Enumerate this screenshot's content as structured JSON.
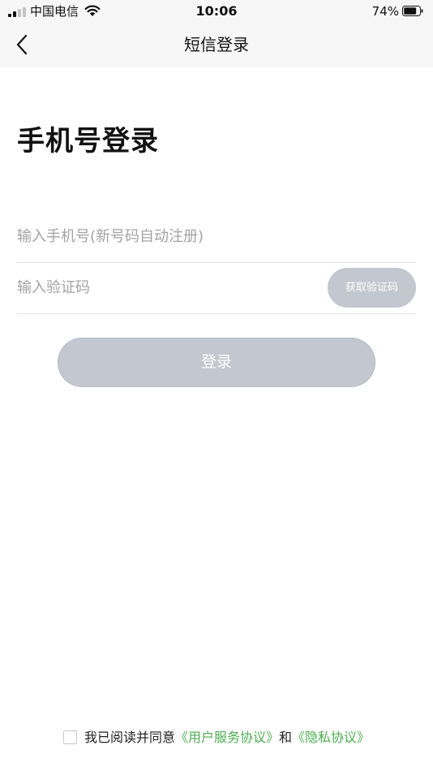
{
  "status_bar": {
    "carrier": "中国电信",
    "time": "10:06",
    "battery_percent": "74%"
  },
  "nav": {
    "title": "短信登录",
    "back_icon": "chevron-left-icon"
  },
  "main": {
    "title": "手机号登录",
    "phone_placeholder": "输入手机号(新号码自动注册)",
    "phone_value": "",
    "code_placeholder": "输入验证码",
    "code_value": "",
    "get_code_label": "获取验证码",
    "login_label": "登录"
  },
  "agreement": {
    "prefix": "我已阅读并同意",
    "user_agreement": "《用户服务协议》",
    "connector": "和",
    "privacy_policy": "《隐私协议》",
    "checked": false
  },
  "colors": {
    "link": "#4caf50",
    "button_disabled": "#c3c7cf",
    "placeholder": "#a3a3a3",
    "bar_background": "#f7f7f7"
  }
}
